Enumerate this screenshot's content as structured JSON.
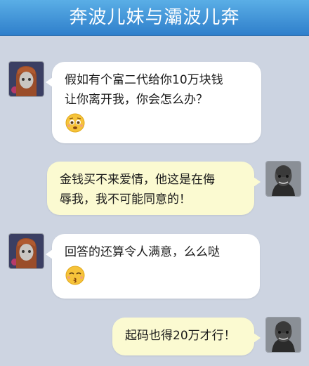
{
  "header": {
    "title": "奔波儿妹与灞波儿奔"
  },
  "messages": [
    {
      "sender": "奔波儿妹",
      "side": "left",
      "lines": [
        "假如有个富二代给你10万块钱",
        "让你离开我，你会怎么办？"
      ],
      "emoji": "worried-face-emoji"
    },
    {
      "sender": "灞波儿奔",
      "side": "right",
      "lines": [
        "金钱买不来爱情，他这是在侮",
        "辱我，我不可能同意的！"
      ]
    },
    {
      "sender": "奔波儿妹",
      "side": "left",
      "lines": [
        "回答的还算令人满意，么么哒"
      ],
      "emoji": "kissing-face-emoji"
    },
    {
      "sender": "灞波儿奔",
      "side": "right",
      "lines": [
        "起码也得20万才行！"
      ]
    }
  ],
  "colors": {
    "header": "#3a8fd8",
    "background": "#cdd4e1",
    "left_bubble": "#ffffff",
    "right_bubble": "#fbfad1"
  }
}
